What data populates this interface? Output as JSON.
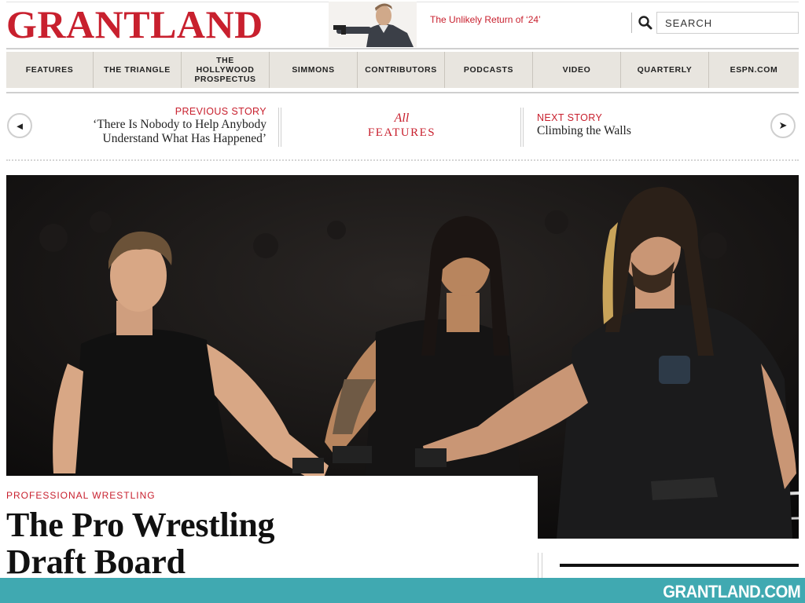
{
  "site": {
    "logo_text": "GRANTLAND"
  },
  "promo": {
    "text": "The Unlikely Return of ‘24’"
  },
  "search": {
    "placeholder": "SEARCH",
    "icon": "search-icon"
  },
  "nav": {
    "items": [
      {
        "label": "FEATURES"
      },
      {
        "label": "THE TRIANGLE"
      },
      {
        "label": "THE HOLLYWOOD PROSPECTUS"
      },
      {
        "label": "SIMMONS"
      },
      {
        "label": "CONTRIBUTORS"
      },
      {
        "label": "PODCASTS"
      },
      {
        "label": "VIDEO"
      },
      {
        "label": "QUARTERLY"
      },
      {
        "label": "ESPN.COM"
      }
    ]
  },
  "story_nav": {
    "prev_arrow": "◄",
    "next_arrow": "➤",
    "previous": {
      "kicker": "PREVIOUS STORY",
      "title": "‘There Is Nobody to Help Anybody Understand What Has Happened’"
    },
    "all": {
      "line1": "All",
      "line2": "FEATURES"
    },
    "next": {
      "kicker": "NEXT STORY",
      "title": "Climbing the Walls"
    }
  },
  "article": {
    "category": "PROFESSIONAL WRESTLING",
    "headline_line1": "The Pro Wrestling",
    "headline_line2": "Draft Board"
  },
  "footer": {
    "brand": "GRANTLAND.COM"
  },
  "colors": {
    "brand_red": "#c8202e",
    "footer_teal": "#40a9b1",
    "nav_bg": "#e8e5df"
  }
}
